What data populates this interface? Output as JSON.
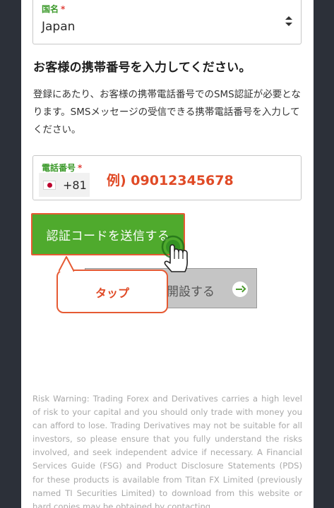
{
  "country": {
    "label": "国名",
    "required_mark": "*",
    "value": "Japan"
  },
  "section": {
    "heading": "お客様の携帯番号を入力してください。",
    "description": "登録にあたり、お客様の携帯電話番号でのSMS認証が必要となります。SMSメッセージの受信できる携帯電話番号を入力してください。"
  },
  "phone": {
    "label": "電話番号",
    "required_mark": "*",
    "dial_code": "+81",
    "example": "例) 09012345678"
  },
  "buttons": {
    "send_code": "認証コードを送信する",
    "open_account": "開設する"
  },
  "annotation": {
    "tap_label": "タップ"
  },
  "colors": {
    "accent_green": "#4faa2d",
    "annotation_orange": "#e65a33",
    "background": "#2c3039"
  },
  "risk_warning": "Risk Warning: Trading Forex and Derivatives carries a high level of risk to your capital and you should only trade with money you can afford to lose. Trading Derivatives may not be suitable for all investors, so please ensure that you fully understand the risks involved, and seek independent advice if necessary. A Financial Services Guide (FSG) and Product Disclosure Statements (PDS) for these products is available from Titan FX Limited (previously named TI Securities Limited) to download from this website or hard copies may be obtained by contacting"
}
